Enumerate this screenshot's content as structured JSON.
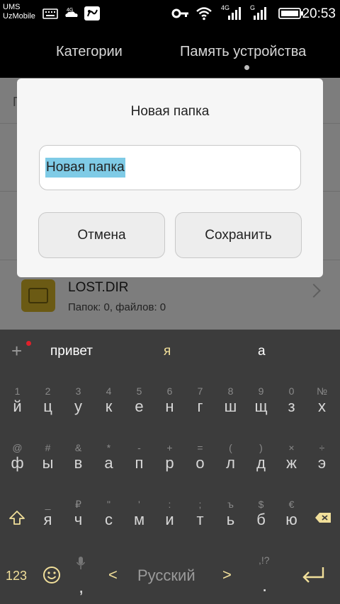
{
  "status_bar": {
    "carrier_line1": "UMS",
    "carrier_line2": "UzMobile",
    "time": "20:53",
    "network_label_1": "4G",
    "network_label_2": "G"
  },
  "tabs": [
    {
      "label": "Категории"
    },
    {
      "label": "Память устройства"
    }
  ],
  "file_list": {
    "peek_letter": "П",
    "items": [
      {
        "name": "LOST.DIR",
        "meta": "Папок: 0, файлов: 0"
      }
    ]
  },
  "dialog": {
    "title": "Новая папка",
    "input_value": "Новая папка",
    "cancel_label": "Отмена",
    "save_label": "Сохранить"
  },
  "keyboard": {
    "suggestions": [
      "привет",
      "я",
      "а"
    ],
    "row1": [
      {
        "sub": "1",
        "main": "й"
      },
      {
        "sub": "2",
        "main": "ц"
      },
      {
        "sub": "3",
        "main": "у"
      },
      {
        "sub": "4",
        "main": "к"
      },
      {
        "sub": "5",
        "main": "е"
      },
      {
        "sub": "6",
        "main": "н"
      },
      {
        "sub": "7",
        "main": "г"
      },
      {
        "sub": "8",
        "main": "ш"
      },
      {
        "sub": "9",
        "main": "щ"
      },
      {
        "sub": "0",
        "main": "з"
      },
      {
        "sub": "№",
        "main": "х"
      }
    ],
    "row2": [
      {
        "sub": "@",
        "main": "ф"
      },
      {
        "sub": "#",
        "main": "ы"
      },
      {
        "sub": "&",
        "main": "в"
      },
      {
        "sub": "*",
        "main": "а"
      },
      {
        "sub": "-",
        "main": "п"
      },
      {
        "sub": "+",
        "main": "р"
      },
      {
        "sub": "=",
        "main": "о"
      },
      {
        "sub": "(",
        "main": "л"
      },
      {
        "sub": ")",
        "main": "д"
      },
      {
        "sub": "×",
        "main": "ж"
      },
      {
        "sub": "÷",
        "main": "э"
      }
    ],
    "row3": [
      {
        "sub": "_",
        "main": "я"
      },
      {
        "sub": "₽",
        "main": "ч"
      },
      {
        "sub": "\"",
        "main": "с"
      },
      {
        "sub": "'",
        "main": "м"
      },
      {
        "sub": ":",
        "main": "и"
      },
      {
        "sub": ";",
        "main": "т"
      },
      {
        "sub": "ъ",
        "main": "ь"
      },
      {
        "sub": "$",
        "main": "б"
      },
      {
        "sub": "€",
        "main": "ю"
      }
    ],
    "key_123": "123",
    "comma": ",",
    "language": "Русский",
    "lang_prev": "<",
    "lang_next": ">",
    "punct_hint": ",!?",
    "period": "."
  },
  "colors": {
    "keyboard_bg": "#3c3c3c",
    "accent_gold": "#f1df9a",
    "selection": "#7fcbe6",
    "dialog_bg": "#f6f6f6"
  }
}
